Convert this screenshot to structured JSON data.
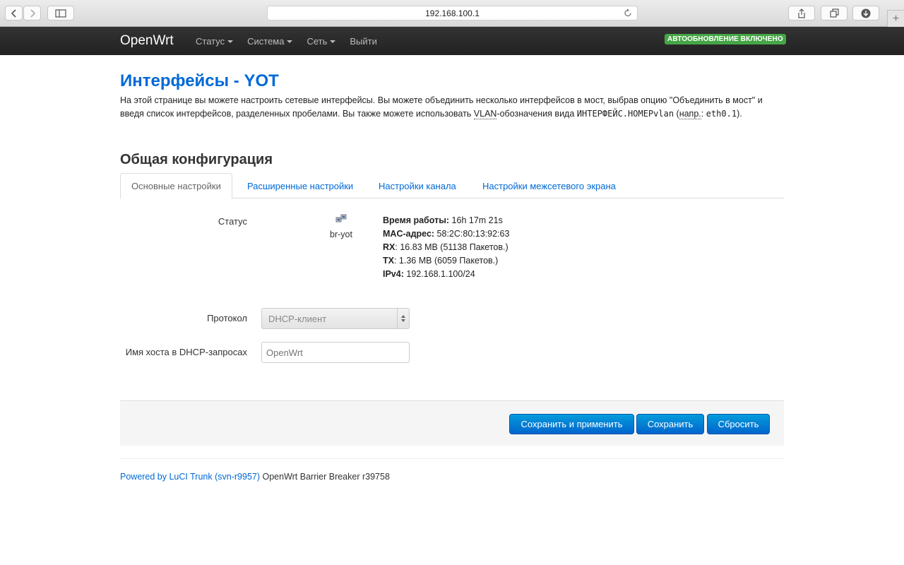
{
  "browser": {
    "url": "192.168.100.1",
    "icons": [
      "back-icon",
      "forward-icon",
      "sidebar-icon",
      "reload-icon",
      "share-icon",
      "tabs-icon",
      "downloads-icon",
      "new-tab-icon"
    ]
  },
  "navbar": {
    "brand": "OpenWrt",
    "menu": [
      {
        "label": "Статус",
        "has_caret": true
      },
      {
        "label": "Система",
        "has_caret": true
      },
      {
        "label": "Сеть",
        "has_caret": true
      },
      {
        "label": "Выйти",
        "has_caret": false
      }
    ],
    "badge": "АВТООБНОВЛЕНИЕ ВКЛЮЧЕНО",
    "badge_color": "#46a546"
  },
  "page": {
    "title": "Интерфейсы - YOT",
    "description": {
      "part1": "На этой странице вы можете настроить сетевые интерфейсы. Вы можете объединить несколько интерфейсов в мост, выбрав опцию \"Объединить в мост\" и введя список интерфейсов, разделенных пробелами. Вы также можете использовать ",
      "vlan": "VLAN",
      "part2": "-обозначения вида ",
      "code1": "ИНТЕРФЕЙС.НОМЕРvlan",
      "part3": " (",
      "example": "напр.",
      "part4": ": ",
      "code2": "eth0.1",
      "part5": ")."
    },
    "section_title": "Общая конфигурация",
    "tabs": [
      {
        "label": "Основные настройки",
        "active": true
      },
      {
        "label": "Расширенные настройки",
        "active": false
      },
      {
        "label": "Настройки канала",
        "active": false
      },
      {
        "label": "Настройки межсетевого экрана",
        "active": false
      }
    ]
  },
  "status": {
    "label": "Статус",
    "interface_icon": "network-bridge-icon",
    "interface_name": "br-yot",
    "uptime_label": "Время работы:",
    "uptime": "16h 17m 21s",
    "mac_label": "MAC-адрес:",
    "mac": "58:2C:80:13:92:63",
    "rx_label": "RX",
    "rx": ": 16.83 MB (51138 Пакетов.)",
    "tx_label": "TX",
    "tx": ": 1.36 MB (6059 Пакетов.)",
    "ipv4_label": "IPv4:",
    "ipv4": "192.168.1.100/24"
  },
  "form": {
    "protocol_label": "Протокол",
    "protocol_value": "DHCP-клиент",
    "hostname_label": "Имя хоста в DHCP-запросах",
    "hostname_placeholder": "OpenWrt"
  },
  "actions": {
    "save_apply": "Сохранить и применить",
    "save": "Сохранить",
    "reset": "Сбросить"
  },
  "footer": {
    "link": "Powered by LuCI Trunk (svn-r9957)",
    "text": " OpenWrt Barrier Breaker r39758"
  },
  "colors": {
    "accent": "#0069d6",
    "navbar": "#222222",
    "button": "#0064cd"
  }
}
